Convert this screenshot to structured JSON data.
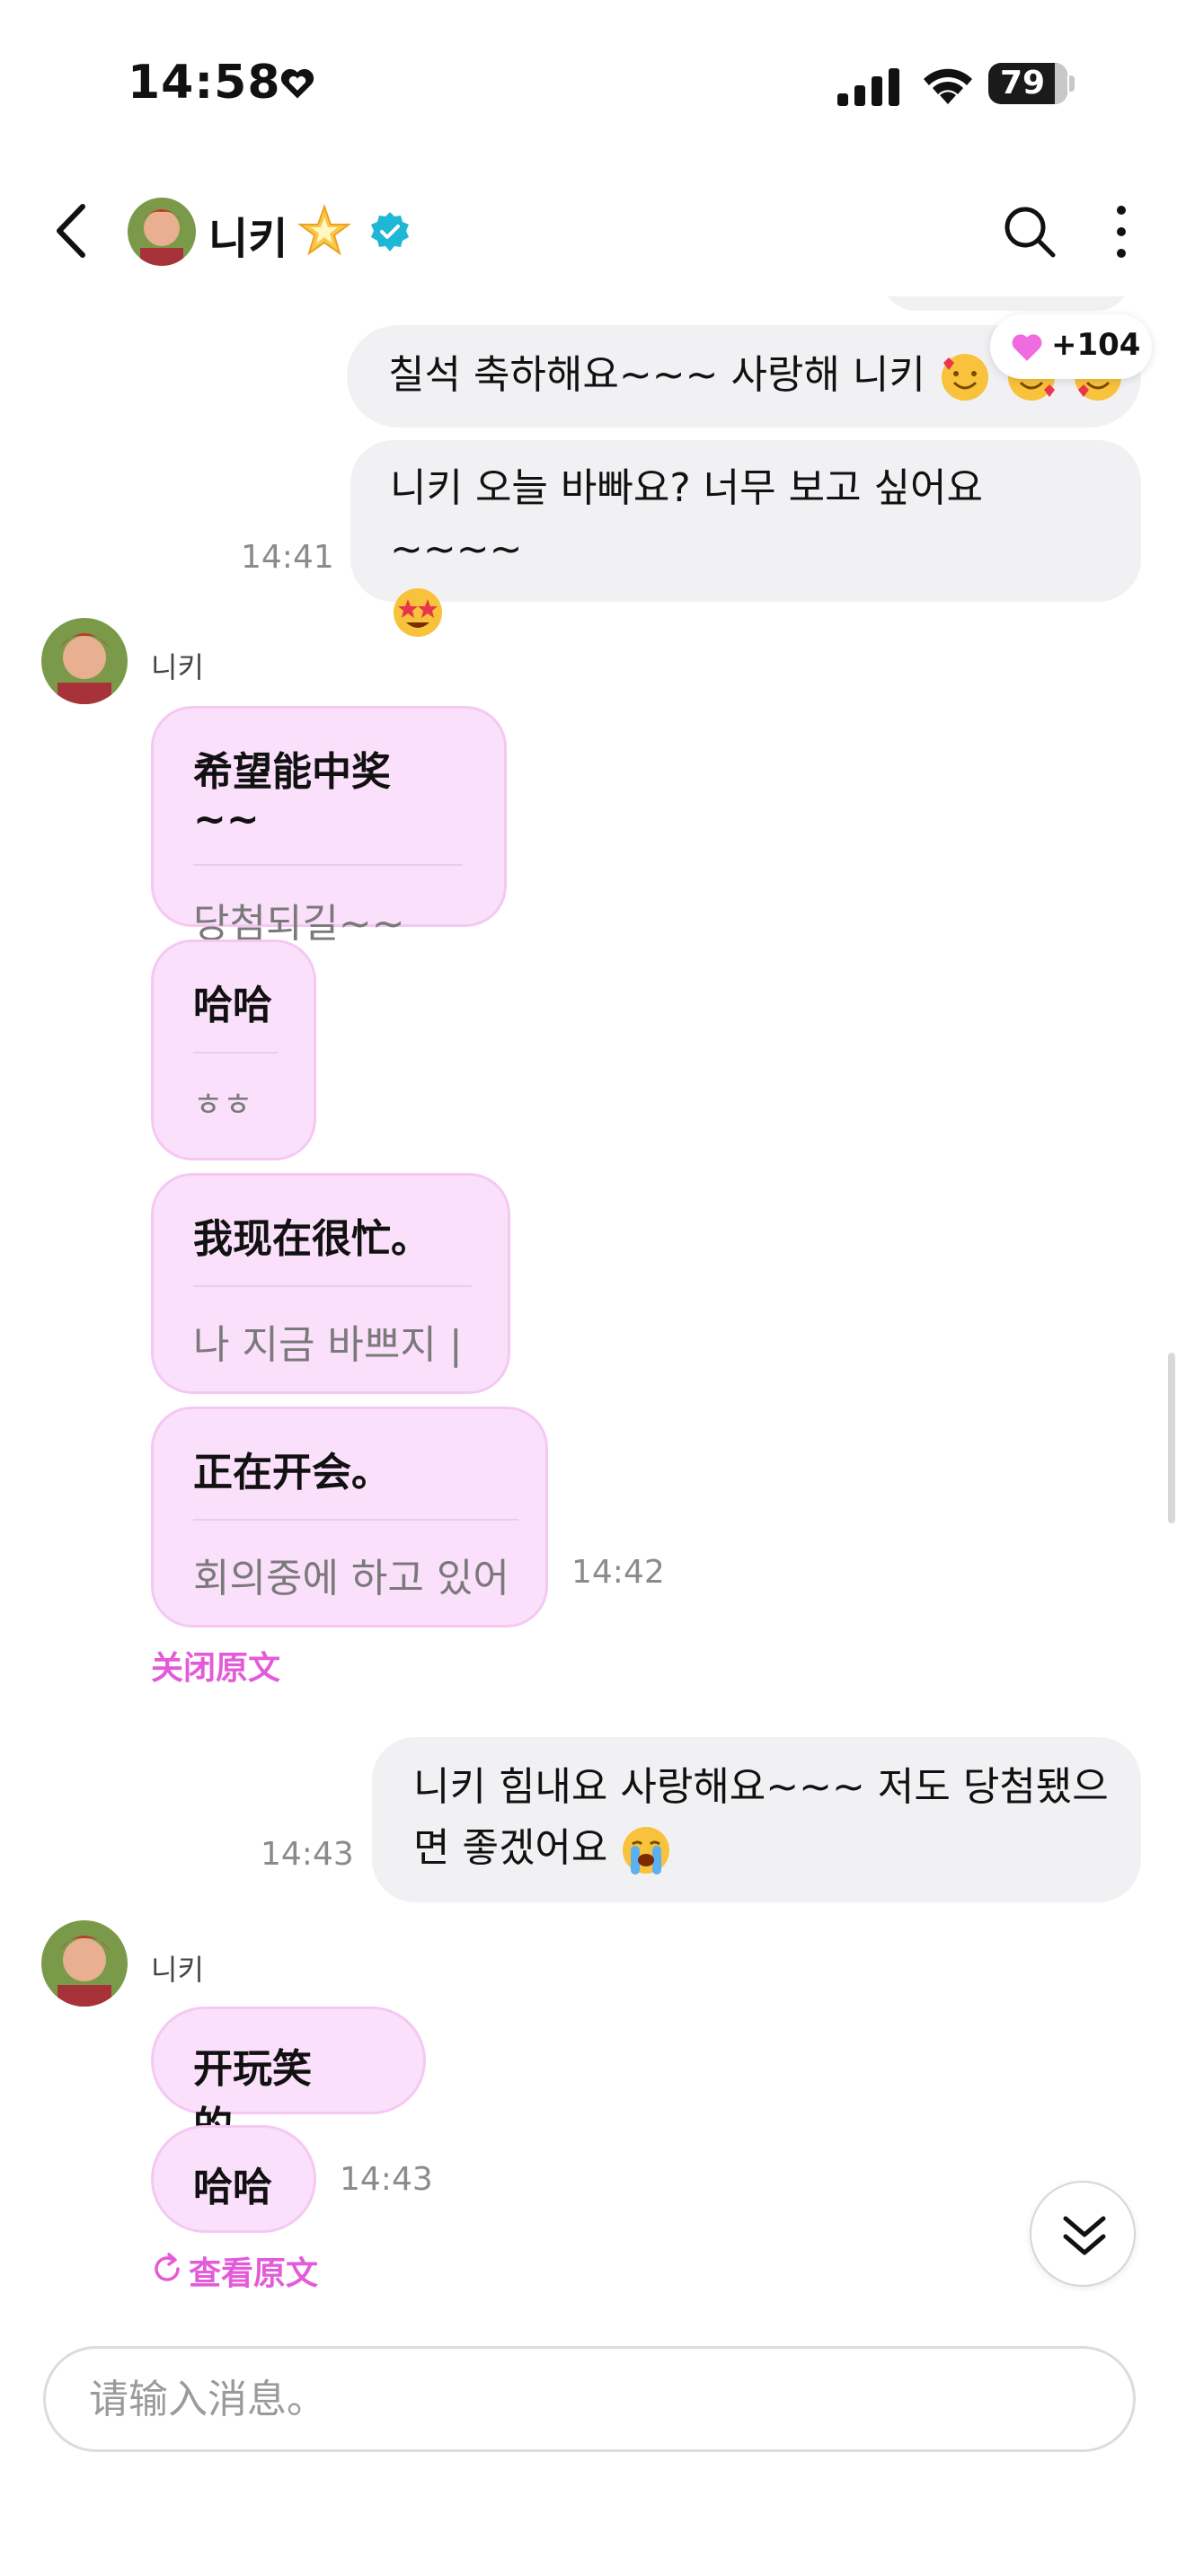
{
  "status_bar": {
    "time": "14:58",
    "battery": "79"
  },
  "header": {
    "name": "니키",
    "star_emoji": "🌟"
  },
  "reaction": {
    "count": "+104"
  },
  "messages": {
    "out1": {
      "text": "칠석 축하해요~~~ 사랑해 니키"
    },
    "out2": {
      "text": "니키 오늘 바빠요? 너무 보고 싶어요~~~~",
      "time": "14:41"
    },
    "in_group1": {
      "sender": "니키",
      "bubbles": [
        {
          "zh": "希望能中奖 ~~",
          "ko": "당첨되길~~"
        },
        {
          "zh": "哈哈",
          "ko": "ㅎㅎ"
        },
        {
          "zh": "我现在很忙。",
          "ko": "나 지금 바쁘지 |"
        },
        {
          "zh": "正在开会。",
          "ko": "회의중에 하고 있어"
        }
      ],
      "time": "14:42",
      "toggle": "关闭原文"
    },
    "out3": {
      "text_line1": "니키 힘내요 사랑해요~~~ 저도 당첨됐으",
      "text_line2": "면 좋겠어요",
      "time": "14:43"
    },
    "in_group2": {
      "sender": "니키",
      "bubbles": [
        {
          "zh": "开玩笑的。"
        },
        {
          "zh": "哈哈"
        }
      ],
      "time": "14:43",
      "toggle": "查看原文"
    }
  },
  "input": {
    "placeholder": "请输入消息。"
  },
  "colors": {
    "incoming_bubble": "#fbe0fb",
    "outgoing_bubble": "#f1f1f4",
    "accent_pink": "#e35bd8",
    "verified_blue": "#1fb7d6"
  },
  "icons": [
    "heart-icon",
    "signal-icon",
    "wifi-icon",
    "back-icon",
    "verified-icon",
    "search-icon",
    "more-icon",
    "chevron-double-down-icon",
    "refresh-icon"
  ]
}
